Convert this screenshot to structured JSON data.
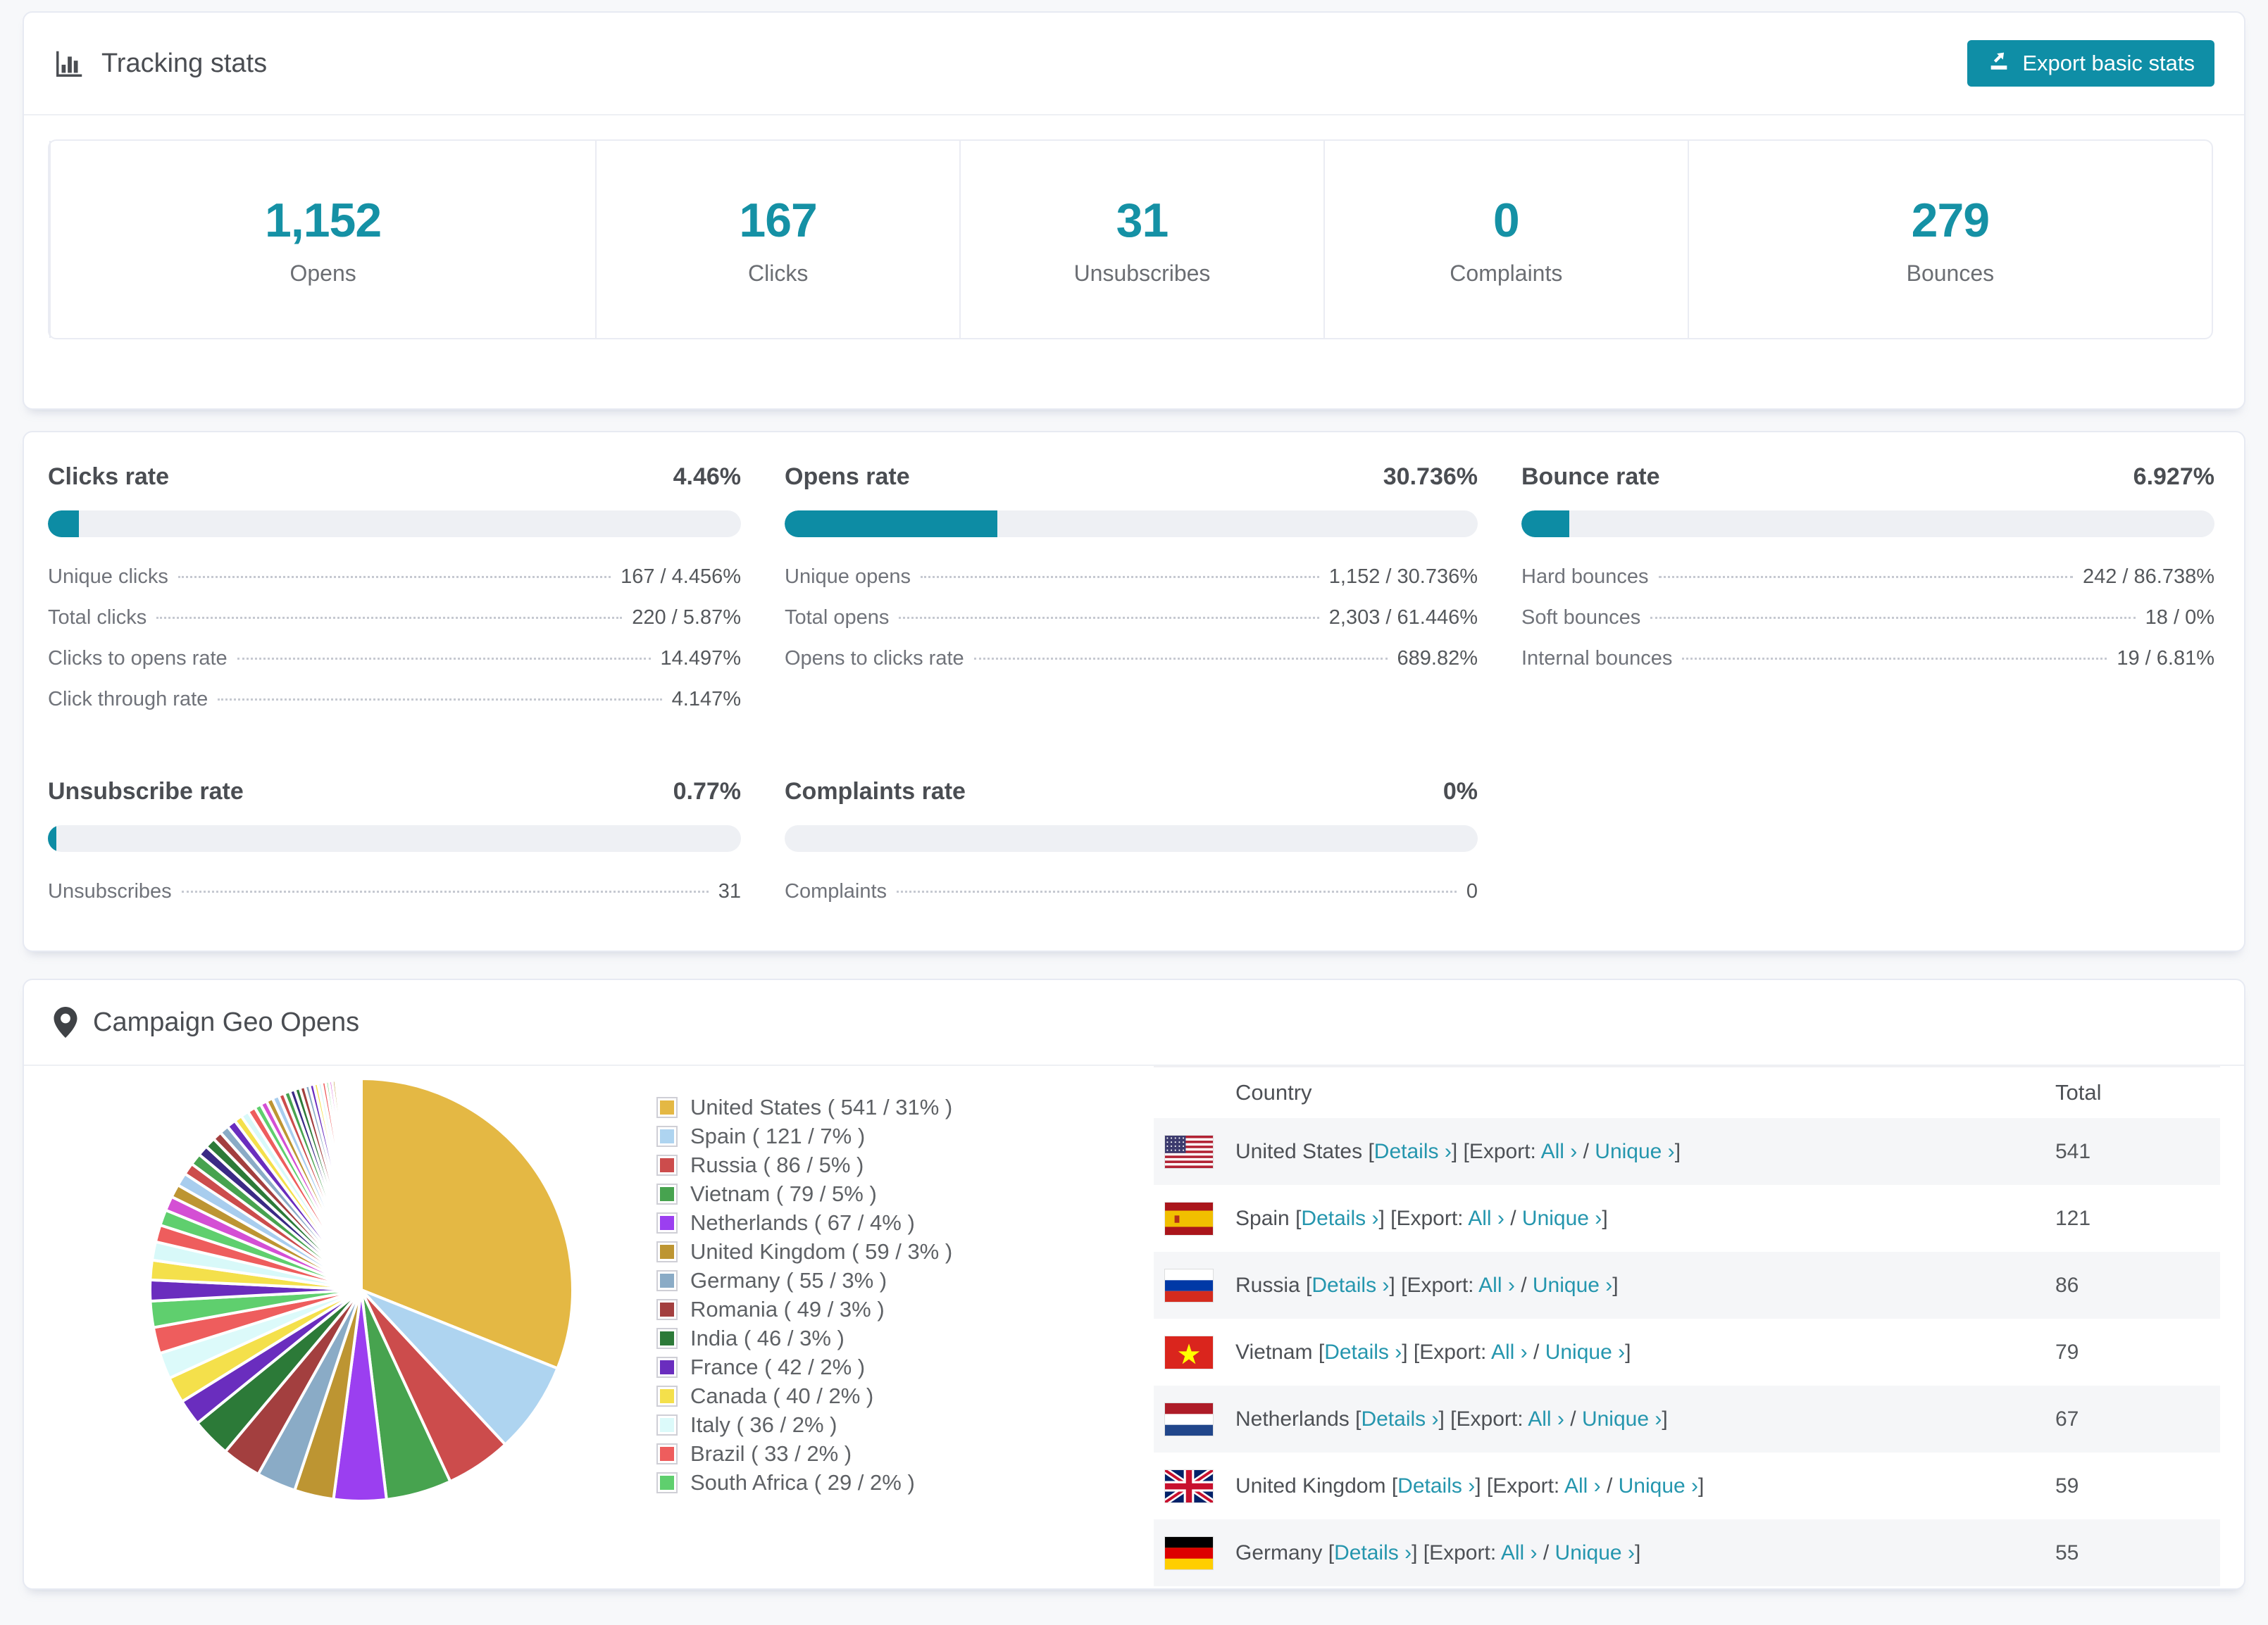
{
  "accent": "#0d8ca4",
  "tracking": {
    "title": "Tracking stats",
    "export_button": "Export basic stats",
    "stats": [
      {
        "value": "1,152",
        "label": "Opens"
      },
      {
        "value": "167",
        "label": "Clicks"
      },
      {
        "value": "31",
        "label": "Unsubscribes"
      },
      {
        "value": "0",
        "label": "Complaints"
      },
      {
        "value": "279",
        "label": "Bounces"
      }
    ]
  },
  "rates": {
    "blocks": [
      {
        "title": "Clicks rate",
        "value": "4.46%",
        "percent": 4.46,
        "rows": [
          {
            "label": "Unique clicks",
            "value": "167 / 4.456%"
          },
          {
            "label": "Total clicks",
            "value": "220 / 5.87%"
          },
          {
            "label": "Clicks to opens rate",
            "value": "14.497%"
          },
          {
            "label": "Click through rate",
            "value": "4.147%"
          }
        ]
      },
      {
        "title": "Opens rate",
        "value": "30.736%",
        "percent": 30.736,
        "rows": [
          {
            "label": "Unique opens",
            "value": "1,152 / 30.736%"
          },
          {
            "label": "Total opens",
            "value": "2,303 / 61.446%"
          },
          {
            "label": "Opens to clicks rate",
            "value": "689.82%"
          }
        ]
      },
      {
        "title": "Bounce rate",
        "value": "6.927%",
        "percent": 6.927,
        "rows": [
          {
            "label": "Hard bounces",
            "value": "242 / 86.738%"
          },
          {
            "label": "Soft bounces",
            "value": "18 / 0%"
          },
          {
            "label": "Internal bounces",
            "value": "19 / 6.81%"
          }
        ]
      },
      {
        "title": "Unsubscribe rate",
        "value": "0.77%",
        "percent": 0.77,
        "rows": [
          {
            "label": "Unsubscribes",
            "value": "31"
          }
        ]
      },
      {
        "title": "Complaints rate",
        "value": "0%",
        "percent": 0,
        "rows": [
          {
            "label": "Complaints",
            "value": "0"
          }
        ]
      }
    ]
  },
  "geo": {
    "title": "Campaign Geo Opens",
    "legend": [
      {
        "label": "United States ( 541 / 31% )",
        "color": "#e4b844"
      },
      {
        "label": "Spain ( 121 / 7% )",
        "color": "#aed4f0"
      },
      {
        "label": "Russia ( 86 / 5% )",
        "color": "#cc4c4c"
      },
      {
        "label": "Vietnam ( 79 / 5% )",
        "color": "#47a34f"
      },
      {
        "label": "Netherlands ( 67 / 4% )",
        "color": "#9b3ff0"
      },
      {
        "label": "United Kingdom ( 59 / 3% )",
        "color": "#bd9532"
      },
      {
        "label": "Germany ( 55 / 3% )",
        "color": "#8aabc6"
      },
      {
        "label": "Romania ( 49 / 3% )",
        "color": "#a33f3f"
      },
      {
        "label": "India ( 46 / 3% )",
        "color": "#2c7a38"
      },
      {
        "label": "France ( 42 / 2% )",
        "color": "#6a2dbe"
      },
      {
        "label": "Canada ( 40 / 2% )",
        "color": "#f4e04b"
      },
      {
        "label": "Italy ( 36 / 2% )",
        "color": "#dcfafa"
      },
      {
        "label": "Brazil ( 33 / 2% )",
        "color": "#ee5d5d"
      },
      {
        "label": "South Africa ( 29 / 2% )",
        "color": "#5fcf6e"
      }
    ],
    "table": {
      "headers": {
        "country": "Country",
        "total": "Total"
      },
      "labels": {
        "bracket_details_open": "[",
        "details": "Details ›",
        "bracket_close": "]",
        "export_prefix": "[Export:",
        "all": "All ›",
        "slash": "/",
        "unique": "Unique ›",
        "end_bracket": "]"
      },
      "rows": [
        {
          "country": "United States",
          "flag": "us",
          "total": "541"
        },
        {
          "country": "Spain",
          "flag": "es",
          "total": "121"
        },
        {
          "country": "Russia",
          "flag": "ru",
          "total": "86"
        },
        {
          "country": "Vietnam",
          "flag": "vn",
          "total": "79"
        },
        {
          "country": "Netherlands",
          "flag": "nl",
          "total": "67"
        },
        {
          "country": "United Kingdom",
          "flag": "gb",
          "total": "59"
        },
        {
          "country": "Germany",
          "flag": "de",
          "total": "55"
        }
      ]
    }
  },
  "chart_data": {
    "type": "pie",
    "title": "Campaign Geo Opens",
    "legend_position": "right",
    "series": [
      {
        "label": "United States",
        "value": 541,
        "pct": 31,
        "color": "#e4b844"
      },
      {
        "label": "Spain",
        "value": 121,
        "pct": 7,
        "color": "#aed4f0"
      },
      {
        "label": "Russia",
        "value": 86,
        "pct": 5,
        "color": "#cc4c4c"
      },
      {
        "label": "Vietnam",
        "value": 79,
        "pct": 5,
        "color": "#47a34f"
      },
      {
        "label": "Netherlands",
        "value": 67,
        "pct": 4,
        "color": "#9b3ff0"
      },
      {
        "label": "United Kingdom",
        "value": 59,
        "pct": 3,
        "color": "#bd9532"
      },
      {
        "label": "Germany",
        "value": 55,
        "pct": 3,
        "color": "#8aabc6"
      },
      {
        "label": "Romania",
        "value": 49,
        "pct": 3,
        "color": "#a33f3f"
      },
      {
        "label": "India",
        "value": 46,
        "pct": 3,
        "color": "#2c7a38"
      },
      {
        "label": "France",
        "value": 42,
        "pct": 2,
        "color": "#6a2dbe"
      },
      {
        "label": "Canada",
        "value": 40,
        "pct": 2,
        "color": "#f4e04b"
      },
      {
        "label": "Italy",
        "value": 36,
        "pct": 2,
        "color": "#dcfafa"
      },
      {
        "label": "Brazil",
        "value": 33,
        "pct": 2,
        "color": "#ee5d5d"
      },
      {
        "label": "South Africa",
        "value": 29,
        "pct": 2,
        "color": "#5fcf6e"
      }
    ],
    "tail": {
      "note": "many small unlabeled country slices visible in the pie",
      "pcts": [
        1.6,
        1.5,
        1.4,
        1.3,
        1.2,
        1.1,
        1.0,
        1.0,
        0.9,
        0.9,
        0.8,
        0.8,
        0.7,
        0.7,
        0.7,
        0.6,
        0.6,
        0.6,
        0.5,
        0.5,
        0.5,
        0.5,
        0.45,
        0.45,
        0.4,
        0.4,
        0.4,
        0.35,
        0.35,
        0.3,
        0.3,
        0.3,
        0.25,
        0.25,
        0.25,
        0.2,
        0.2,
        0.2,
        0.2,
        0.15,
        0.15,
        0.15,
        0.1,
        0.1,
        0.1,
        0.1,
        0.1,
        0.1,
        0.05,
        0.05
      ],
      "palette": [
        "#6a2dbe",
        "#f4e04b",
        "#d8f9f9",
        "#ee5d5d",
        "#5fcf6e",
        "#d44fd4",
        "#bd9532",
        "#a8cdee",
        "#cc4c4c",
        "#47a34f",
        "#3a2a85",
        "#2c7a38",
        "#a33f3f",
        "#8aabc6"
      ]
    }
  }
}
